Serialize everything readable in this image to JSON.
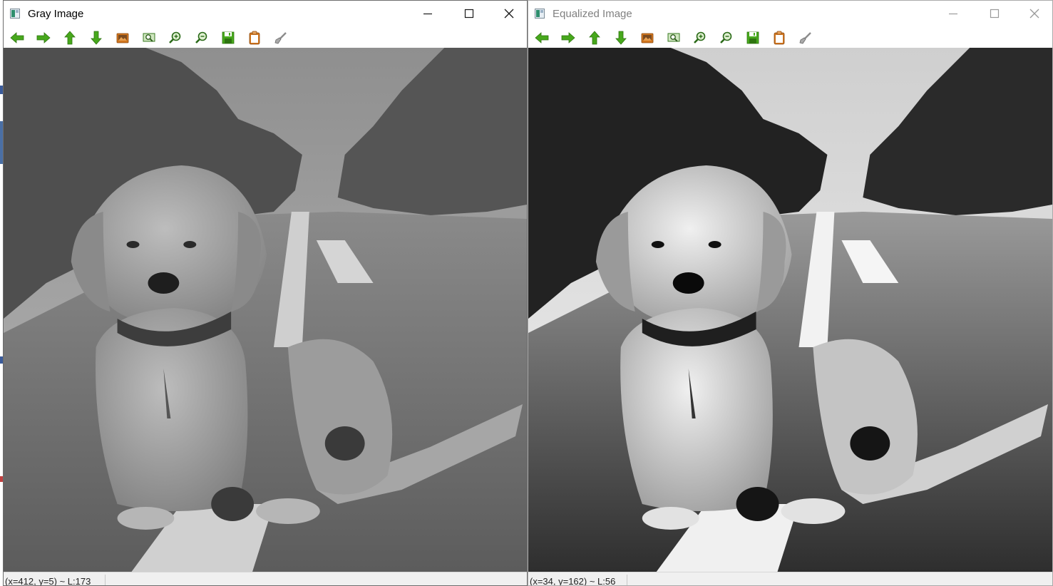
{
  "windows": {
    "left": {
      "title": "Gray Image",
      "status": "(x=412, y=5) ~ L:173"
    },
    "right": {
      "title": "Equalized Image",
      "status": "(x=34, y=162) ~ L:56",
      "state": "inactive"
    }
  },
  "toolbar": {
    "buttons": [
      {
        "name": "pan-left",
        "icon": "arrow-left-icon"
      },
      {
        "name": "pan-right",
        "icon": "arrow-right-icon"
      },
      {
        "name": "pan-up",
        "icon": "arrow-up-icon"
      },
      {
        "name": "pan-down",
        "icon": "arrow-down-icon"
      },
      {
        "name": "zoom-original",
        "icon": "picture-icon"
      },
      {
        "name": "zoom-fit",
        "icon": "zoom-fit-icon"
      },
      {
        "name": "zoom-in",
        "icon": "zoom-in-icon"
      },
      {
        "name": "zoom-out",
        "icon": "zoom-out-icon"
      },
      {
        "name": "save",
        "icon": "save-icon"
      },
      {
        "name": "copy-to-clipboard",
        "icon": "clipboard-icon"
      },
      {
        "name": "properties",
        "icon": "brush-icon"
      }
    ]
  },
  "colors": {
    "icon_green": "#47a81c",
    "icon_orange": "#d2761e"
  }
}
